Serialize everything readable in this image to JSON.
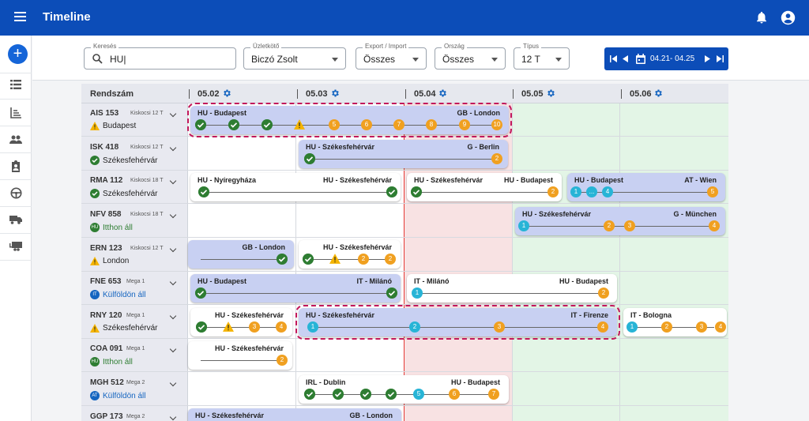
{
  "app": {
    "title": "Timeline"
  },
  "filters": {
    "search": {
      "label": "Keresés",
      "value": "HU|"
    },
    "agent": {
      "label": "Üzletkötő",
      "value": "Biczó Zsolt"
    },
    "export": {
      "label": "Export / Import",
      "value": "Összes"
    },
    "country": {
      "label": "Ország",
      "value": "Összes"
    },
    "type": {
      "label": "Típus",
      "value": "12 T"
    },
    "date_range": "04.21- 04.25"
  },
  "header": {
    "col_label": "Rendszám",
    "dates": [
      "05.02",
      "05.03",
      "05.04",
      "05.05",
      "05.06"
    ]
  },
  "colors": {
    "primary": "#0c4db8",
    "green": "#2e7d32",
    "orange": "#f0a020",
    "cyan": "#27b4d6",
    "highlight": "#c2185b",
    "today": "#e53935"
  },
  "vehicles": [
    {
      "plate": "AIS 153",
      "type": "Kiskocsi 12 T",
      "status": "Budapest",
      "status_icon": "warning-icon"
    },
    {
      "plate": "ISK 418",
      "type": "Kiskocsi 12 T",
      "status": "Székesfehérvár",
      "status_icon": "check-icon"
    },
    {
      "plate": "RMA 112",
      "type": "Kiskocsi 18 T",
      "status": "Székesfehérvár",
      "status_icon": "check-icon"
    },
    {
      "plate": "NFV 858",
      "type": "Kiskocsi 18 T",
      "status": "Itthon áll",
      "status_icon": "hu-badge-icon",
      "badge": "HU"
    },
    {
      "plate": "ERN 123",
      "type": "Kiskocsi 12 T",
      "status": "London",
      "status_icon": "warning-icon"
    },
    {
      "plate": "FNE 653",
      "type": "Mega 1",
      "status": "Külföldön áll",
      "status_icon": "it-badge-icon",
      "badge": "IT"
    },
    {
      "plate": "RNY 120",
      "type": "Mega 1",
      "status": "Székesfehérvár",
      "status_icon": "warning-icon"
    },
    {
      "plate": "COA 091",
      "type": "Mega 1",
      "status": "Itthon áll",
      "status_icon": "hu-badge-icon",
      "badge": "HU"
    },
    {
      "plate": "MGH 512",
      "type": "Mega 2",
      "status": "Külföldön áll",
      "status_icon": "at-badge-icon",
      "badge": "AT"
    },
    {
      "plate": "GGP 173",
      "type": "Mega 2",
      "status": "",
      "status_icon": ""
    }
  ],
  "trips": [
    {
      "from": "HU - Budapest",
      "to": "GB - London",
      "stops": [
        "5",
        "6",
        "7",
        "8",
        "9",
        "10"
      ]
    },
    {
      "from": "HU - Székesfehérvár",
      "to": "G - Berlin",
      "stops": [
        "2"
      ]
    },
    {
      "from": "HU - Nyíregyháza",
      "to": "HU - Székesfehérvár",
      "stops": []
    },
    {
      "from": "HU - Székesfehérvár",
      "to": "HU - Budapest",
      "stops": [
        "2"
      ]
    },
    {
      "from": "HU - Budapest",
      "to": "AT - Wien",
      "stops": [
        "1",
        "...",
        "4",
        "5"
      ]
    },
    {
      "from": "HU - Székesfehérvár",
      "to": "G - München",
      "stops": [
        "1",
        "2",
        "3",
        "4"
      ]
    },
    {
      "from": "",
      "to": "GB - London",
      "stops": []
    },
    {
      "from": "",
      "to": "HU - Székesfehérvár",
      "stops": [
        "2",
        "2"
      ]
    },
    {
      "from": "HU - Budapest",
      "to": "IT - Milánó",
      "stops": []
    },
    {
      "from": "IT - Milánó",
      "to": "HU - Budapest",
      "stops": [
        "1",
        "2"
      ]
    },
    {
      "from": "",
      "to": "HU - Székesfehérvár",
      "stops": [
        "3",
        "4"
      ]
    },
    {
      "from": "HU - Székesfehérvár",
      "to": "IT - Firenze",
      "stops": [
        "1",
        "2",
        "3",
        "4"
      ]
    },
    {
      "from": "IT - Bologna",
      "to": "",
      "stops": [
        "1",
        "2",
        "3",
        "4"
      ]
    },
    {
      "from": "",
      "to": "HU - Székesfehérvár",
      "stops": [
        "2"
      ]
    },
    {
      "from": "IRL - Dublin",
      "to": "HU - Budapest",
      "stops": [
        "5",
        "6",
        "7"
      ]
    },
    {
      "from": "HU - Székesfehérvár",
      "to": "GB - London",
      "stops": []
    }
  ]
}
